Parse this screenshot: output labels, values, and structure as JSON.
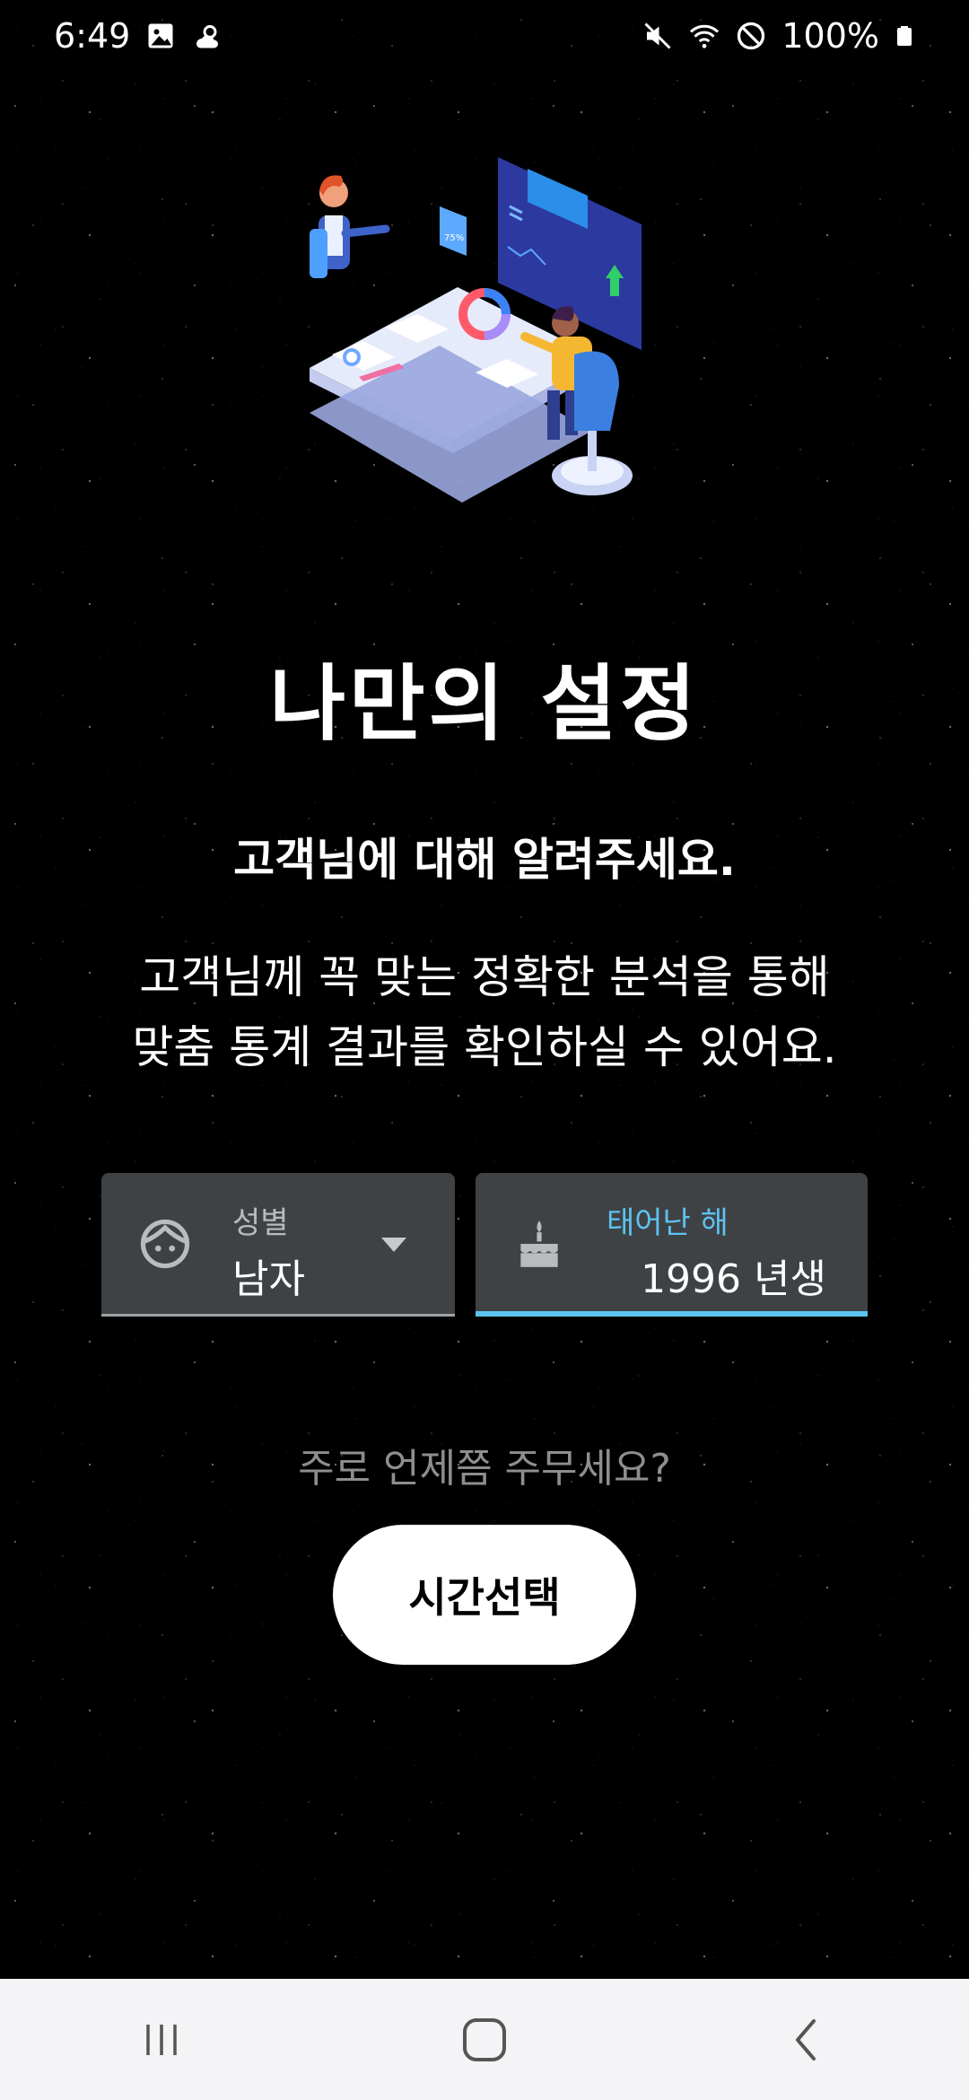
{
  "status_bar": {
    "time": "6:49",
    "battery_percent": "100%",
    "icons": [
      "gallery-icon",
      "weather-icon",
      "mute-icon",
      "wifi-icon",
      "no-disturb-icon",
      "battery-icon"
    ]
  },
  "main": {
    "title": "나만의 설정",
    "subtitle": "고객님에 대해 알려주세요.",
    "description_line1": "고객님께 꼭 맞는 정확한 분석을 통해",
    "description_line2": "맞춤 통계 결과를 확인하실 수 있어요."
  },
  "gender_field": {
    "label": "성별",
    "value": "남자",
    "icon": "face-icon"
  },
  "birth_field": {
    "label": "태어난 해",
    "value": "1996 년생",
    "icon": "cake-icon",
    "accent_color": "#5ec2ef"
  },
  "question": "주로 언제쯤 주무세요?",
  "time_button_label": "시간선택",
  "nav": {
    "items": [
      "recent-apps-icon",
      "home-icon",
      "back-icon"
    ]
  }
}
